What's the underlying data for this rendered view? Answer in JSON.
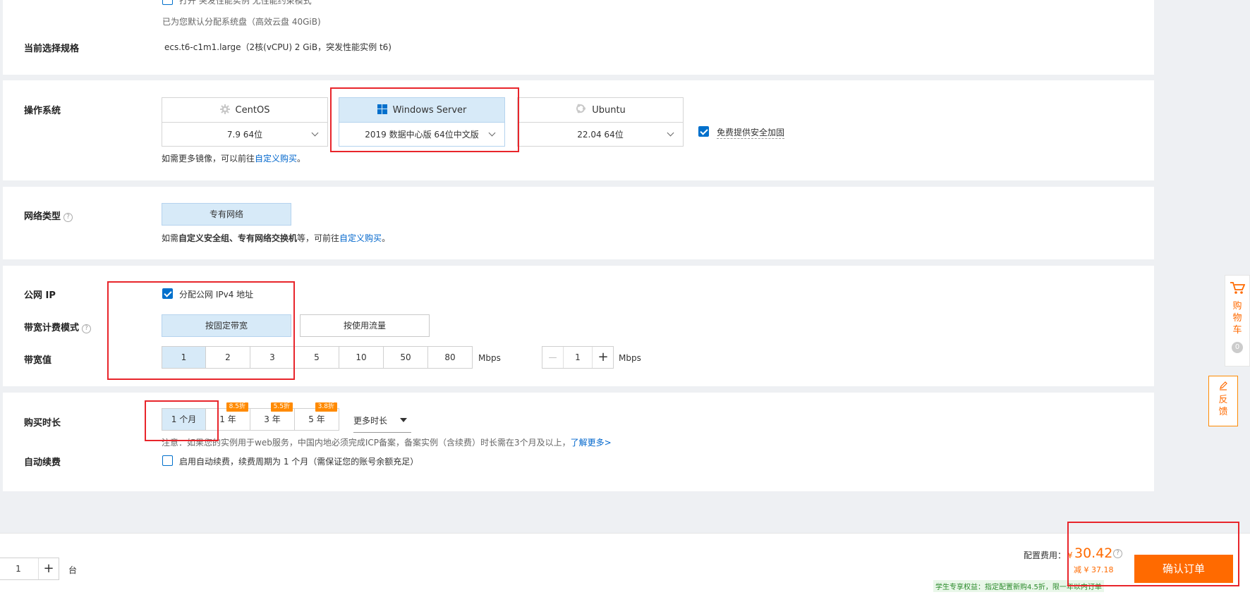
{
  "top": {
    "burst_checkbox_label": "打开 突发性能实例 无性能约束模式",
    "disk_note": "已为您默认分配系统盘（高效云盘 40GiB)"
  },
  "spec": {
    "label": "当前选择规格",
    "value": "ecs.t6-c1m1.large（2核(vCPU) 2 GiB，突发性能实例 t6)"
  },
  "os": {
    "label": "操作系统",
    "cards": [
      {
        "name": "CentOS",
        "version": "7.9 64位",
        "icon": "centos-gear-icon"
      },
      {
        "name": "Windows Server",
        "version": "2019 数据中心版 64位中文版",
        "icon": "windows-icon"
      },
      {
        "name": "Ubuntu",
        "version": "22.04 64位",
        "icon": "ubuntu-icon"
      }
    ],
    "security_label": "免费提供安全加固",
    "more_prefix": "如需更多镜像，可以前往",
    "more_link": "自定义购买",
    "more_suffix": "。"
  },
  "network": {
    "label": "网络类型",
    "option": "专有网络",
    "note_p1": "如需",
    "note_bold": "自定义安全组、专有网络交换机",
    "note_p2": "等，可前往",
    "note_link": "自定义购买",
    "note_end": "。"
  },
  "public_ip": {
    "label": "公网 IP",
    "checkbox_label": "分配公网 IPv4 地址"
  },
  "billing": {
    "label": "带宽计费模式",
    "options": [
      "按固定带宽",
      "按使用流量"
    ]
  },
  "bandwidth": {
    "label": "带宽值",
    "options": [
      "1",
      "2",
      "3",
      "5",
      "10",
      "50",
      "80"
    ],
    "unit": "Mbps",
    "stepper_value": "1",
    "stepper_unit": "Mbps"
  },
  "duration": {
    "label": "购买时长",
    "options": [
      {
        "label": "1 个月",
        "discount": ""
      },
      {
        "label": "1 年",
        "discount": "8.5折"
      },
      {
        "label": "3 年",
        "discount": "5.5折"
      },
      {
        "label": "5 年",
        "discount": "3.8折"
      }
    ],
    "more": "更多时长",
    "note": "注意：如果您的实例用于web服务，中国内地必须完成ICP备案，备案实例（含续费）时长需在3个月及以上，",
    "note_link": "了解更多>"
  },
  "auto_renew": {
    "label": "自动续费",
    "checkbox_label": "启用自动续费，续费周期为 1 个月（需保证您的账号余额充足）"
  },
  "footer": {
    "quantity": "1",
    "quantity_unit": "台",
    "fee_label": "配置费用：",
    "currency": "¥",
    "price": "30.42",
    "discount": "减 ¥ 37.18",
    "confirm": "确认订单",
    "student_note": "学生专享权益：指定配置新购4.5折，限一年以内订单"
  },
  "side": {
    "cart_label": "购物车",
    "cart_count": "0",
    "feedback_label": "反馈"
  },
  "colors": {
    "accent_blue": "#0070cc",
    "selected_bg": "#d7eaf8",
    "orange": "#ff6a00",
    "annotation_red": "#e8252b"
  }
}
